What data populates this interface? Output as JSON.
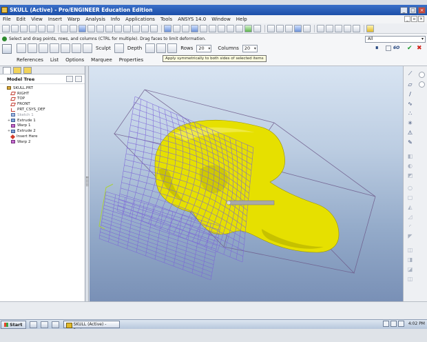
{
  "window": {
    "title": "SKULL (Active) - Pro/ENGINEER Education Edition",
    "minimize": "_",
    "maximize": "□",
    "close": "×"
  },
  "menu": [
    "File",
    "Edit",
    "View",
    "Insert",
    "Warp",
    "Analysis",
    "Info",
    "Applications",
    "Tools",
    "ANSYS 14.0",
    "Window",
    "Help"
  ],
  "dashboard": {
    "message": "Select and drag points, rows, and columns (CTRL for multiple). Drag faces to limit deformation.",
    "sculpt_label": "Sculpt",
    "depth_label": "Depth",
    "rows_label": "Rows",
    "rows_value": "20",
    "columns_label": "Columns",
    "columns_value": "20",
    "tooltip": "Apply symmetrically to both sides of selected items",
    "filter_value": "All",
    "tabs": [
      "References",
      "List",
      "Options",
      "Marquee",
      "Properties"
    ],
    "pause_icon": "⏸",
    "ok_icon": "✔",
    "cancel_icon": "✖",
    "preview_label": "6O"
  },
  "model_tree": {
    "title": "Model Tree",
    "items": [
      {
        "label": "SKULL.PRT",
        "icon": "part-icon",
        "expand": "",
        "indent": 0,
        "greyed": false
      },
      {
        "label": "RIGHT",
        "icon": "datum-plane-icon",
        "expand": "",
        "indent": 1,
        "greyed": false
      },
      {
        "label": "TOP",
        "icon": "datum-plane-icon",
        "expand": "",
        "indent": 1,
        "greyed": false
      },
      {
        "label": "FRONT",
        "icon": "datum-plane-icon",
        "expand": "",
        "indent": 1,
        "greyed": false
      },
      {
        "label": "PRT_CSYS_DEF",
        "icon": "csys-icon",
        "expand": "",
        "indent": 1,
        "greyed": false
      },
      {
        "label": "Sketch 1",
        "icon": "sketch-icon",
        "expand": "",
        "indent": 1,
        "greyed": true
      },
      {
        "label": "Extrude 1",
        "icon": "extrude-icon",
        "expand": "+",
        "indent": 1,
        "greyed": false
      },
      {
        "label": "Warp 1",
        "icon": "warp-icon",
        "expand": "",
        "indent": 1,
        "greyed": false
      },
      {
        "label": "Extrude 2",
        "icon": "extrude-icon",
        "expand": "+",
        "indent": 1,
        "greyed": false
      },
      {
        "label": "Insert Here",
        "icon": "insert-here-icon",
        "expand": "",
        "indent": 1,
        "greyed": false
      },
      {
        "label": "Warp 2",
        "icon": "warp-icon",
        "expand": "",
        "indent": 1,
        "greyed": false
      }
    ]
  },
  "taskbar": {
    "start_label": "Start",
    "active_window": "SKULL (Active) - Pro/...",
    "clock": "4:02 PM"
  },
  "colors": {
    "model_yellow": "#e5e000",
    "lattice_purple": "#7b64d8",
    "title_blue": "#1f56b3"
  }
}
